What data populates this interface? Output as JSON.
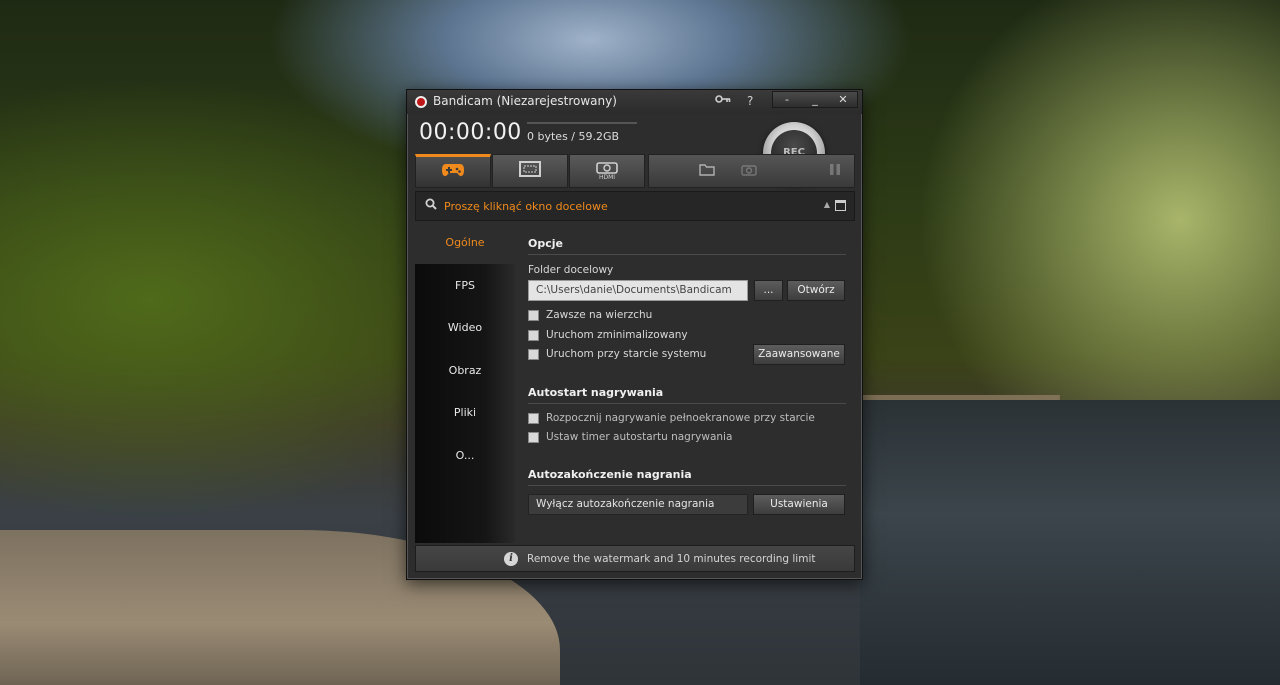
{
  "window": {
    "title": "Bandicam (Niezarejestrowany)",
    "key_icon": "key-icon",
    "help_label": "?",
    "minimize_compact_label": "-",
    "minimize_label": "_",
    "close_label": "✕"
  },
  "status": {
    "timer": "00:00:00",
    "size": "0 bytes / 59.2GB",
    "rec_label": "REC"
  },
  "modes": [
    {
      "name": "game-mode",
      "icon": "gamepad-icon",
      "active": true
    },
    {
      "name": "screen-mode",
      "icon": "screen-rectangle-icon",
      "active": false
    },
    {
      "name": "device-mode",
      "icon": "hdmi-icon",
      "label": "HDMI",
      "active": false
    }
  ],
  "tools": {
    "folder_icon": "folder-icon",
    "camera_icon": "camera-icon",
    "pause_icon": "pause-icon"
  },
  "target": {
    "text": "Proszę kliknąć okno docelowe"
  },
  "sidebar": {
    "items": [
      {
        "label": "Ogólne",
        "active": true
      },
      {
        "label": "FPS",
        "active": false
      },
      {
        "label": "Wideo",
        "active": false
      },
      {
        "label": "Obraz",
        "active": false
      },
      {
        "label": "Pliki",
        "active": false
      },
      {
        "label": "O...",
        "active": false
      }
    ]
  },
  "options": {
    "title": "Opcje",
    "folder_label": "Folder docelowy",
    "folder_path": "C:\\Users\\danie\\Documents\\Bandicam",
    "browse_label": "...",
    "open_label": "Otwórz",
    "always_on_top": "Zawsze na wierzchu",
    "start_minimized": "Uruchom zminimalizowany",
    "start_on_boot": "Uruchom przy starcie systemu",
    "advanced_label": "Zaawansowane"
  },
  "autostart": {
    "title": "Autostart nagrywania",
    "fullscreen_start": "Rozpocznij nagrywanie pełnoekranowe przy starcie",
    "timer": "Ustaw timer autostartu nagrywania"
  },
  "autostop": {
    "title": "Autozakończenie nagrania",
    "value": "Wyłącz autozakończenie nagrania",
    "settings_label": "Ustawienia"
  },
  "footer": {
    "info_icon_text": "i",
    "text": "Remove the watermark and 10 minutes recording limit"
  },
  "colors": {
    "accent": "#f08a1c",
    "window_bg": "#2d2d2d"
  }
}
